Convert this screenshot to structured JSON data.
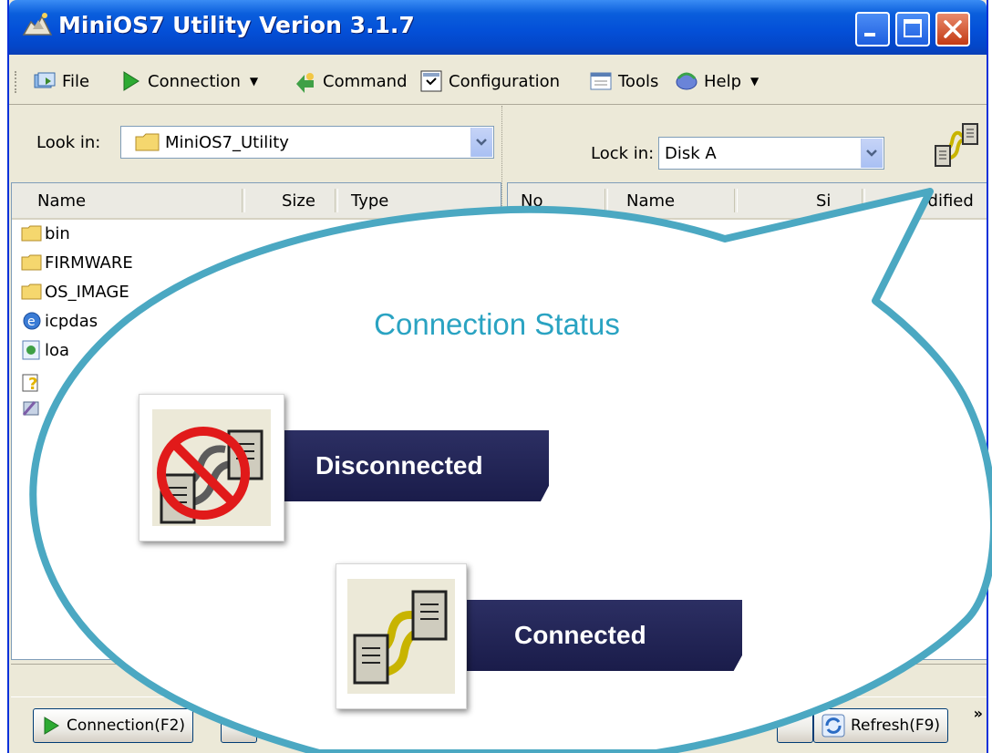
{
  "window": {
    "title": "MiniOS7 Utility Verion 3.1.7"
  },
  "menu": {
    "file": "File",
    "connection": "Connection",
    "command": "Command",
    "configuration": "Configuration",
    "tools": "Tools",
    "help": "Help"
  },
  "left_pane": {
    "look_in_label": "Look in:",
    "look_in_value": "MiniOS7_Utility",
    "columns": [
      "Name",
      "Size",
      "Type"
    ],
    "files": [
      {
        "name": "bin",
        "icon": "folder-icon"
      },
      {
        "name": "FIRMWARE",
        "icon": "folder-icon"
      },
      {
        "name": "OS_IMAGE",
        "icon": "folder-icon"
      },
      {
        "name": "icpdas",
        "icon": "internet-shortcut-icon"
      },
      {
        "name": "loa",
        "icon": "executable-icon"
      }
    ]
  },
  "right_pane": {
    "lock_in_label": "Lock in:",
    "lock_in_value": "Disk A",
    "columns": [
      "No",
      "Name",
      "Si",
      "Modified"
    ],
    "status_icon": "connection-status-icon"
  },
  "bottom_buttons": {
    "connection": "Connection(F2)",
    "refresh": "Refresh(F9)",
    "overflow": "»"
  },
  "callout": {
    "title": "Connection Status",
    "disconnected_label": "Disconnected",
    "connected_label": "Connected",
    "border_color": "#4BA8C2",
    "banner_color": "#24275A"
  }
}
